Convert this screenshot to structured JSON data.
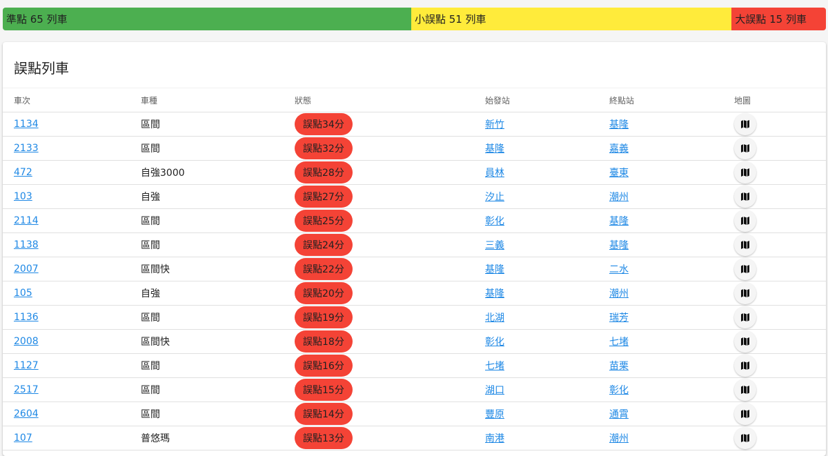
{
  "status_bar": {
    "segments": [
      {
        "label": "準點 65 列車",
        "count": 65,
        "color": "#4caf50"
      },
      {
        "label": "小誤點 51 列車",
        "count": 51,
        "color": "#ffeb3b"
      },
      {
        "label": "大誤點 15 列車",
        "count": 15,
        "color": "#f44336"
      }
    ]
  },
  "card": {
    "title": "誤點列車"
  },
  "table": {
    "headers": {
      "train_no": "車次",
      "train_type": "車種",
      "status": "狀態",
      "origin": "始發站",
      "destination": "終點站",
      "map": "地圖"
    },
    "map_icon": "map-icon",
    "rows": [
      {
        "train_no": "1134",
        "train_type": "區間",
        "status": "誤點34分",
        "origin": "新竹",
        "destination": "基隆"
      },
      {
        "train_no": "2133",
        "train_type": "區間",
        "status": "誤點32分",
        "origin": "基隆",
        "destination": "嘉義"
      },
      {
        "train_no": "472",
        "train_type": "自強3000",
        "status": "誤點28分",
        "origin": "員林",
        "destination": "臺東"
      },
      {
        "train_no": "103",
        "train_type": "自強",
        "status": "誤點27分",
        "origin": "汐止",
        "destination": "潮州"
      },
      {
        "train_no": "2114",
        "train_type": "區間",
        "status": "誤點25分",
        "origin": "彰化",
        "destination": "基隆"
      },
      {
        "train_no": "1138",
        "train_type": "區間",
        "status": "誤點24分",
        "origin": "三義",
        "destination": "基隆"
      },
      {
        "train_no": "2007",
        "train_type": "區間快",
        "status": "誤點22分",
        "origin": "基隆",
        "destination": "二水"
      },
      {
        "train_no": "105",
        "train_type": "自強",
        "status": "誤點20分",
        "origin": "基隆",
        "destination": "潮州"
      },
      {
        "train_no": "1136",
        "train_type": "區間",
        "status": "誤點19分",
        "origin": "北湖",
        "destination": "瑞芳"
      },
      {
        "train_no": "2008",
        "train_type": "區間快",
        "status": "誤點18分",
        "origin": "彰化",
        "destination": "七堵"
      },
      {
        "train_no": "1127",
        "train_type": "區間",
        "status": "誤點16分",
        "origin": "七堵",
        "destination": "苗栗"
      },
      {
        "train_no": "2517",
        "train_type": "區間",
        "status": "誤點15分",
        "origin": "湖口",
        "destination": "彰化"
      },
      {
        "train_no": "2604",
        "train_type": "區間",
        "status": "誤點14分",
        "origin": "豐原",
        "destination": "通霄"
      },
      {
        "train_no": "107",
        "train_type": "普悠瑪",
        "status": "誤點13分",
        "origin": "南港",
        "destination": "潮州"
      }
    ]
  }
}
